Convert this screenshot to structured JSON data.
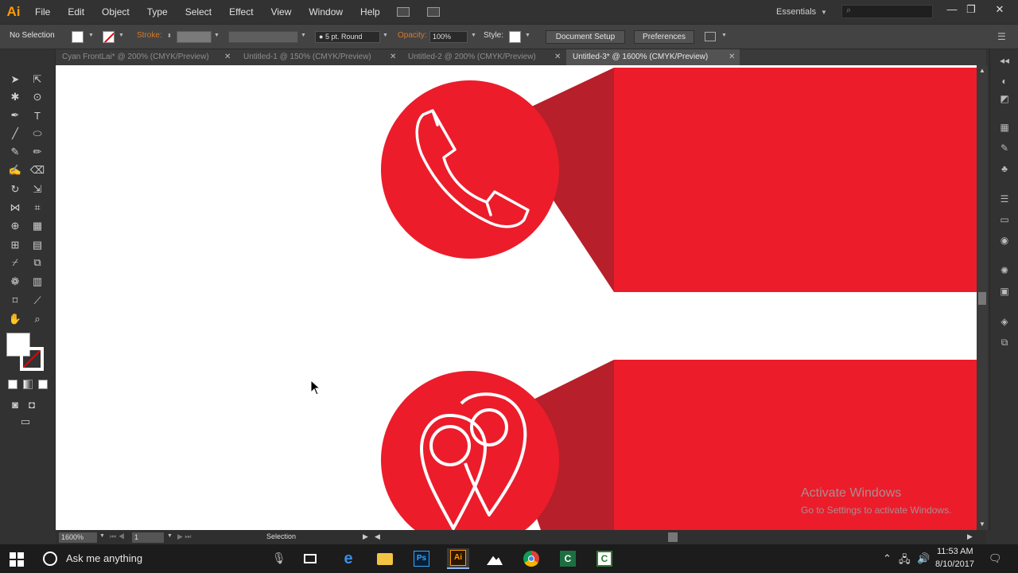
{
  "app": {
    "logo": "Ai"
  },
  "menu": [
    "File",
    "Edit",
    "Object",
    "Type",
    "Select",
    "Effect",
    "View",
    "Window",
    "Help"
  ],
  "workspace": "Essentials",
  "control_bar": {
    "selection": "No Selection",
    "stroke_label": "Stroke:",
    "brush": "5 pt. Round",
    "opacity_label": "Opacity:",
    "opacity_value": "100%",
    "style_label": "Style:",
    "document_setup": "Document Setup",
    "preferences": "Preferences"
  },
  "tabs": [
    {
      "label": "Cyan FrontLai* @ 200% (CMYK/Preview)",
      "active": false
    },
    {
      "label": "Untitled-1 @ 150% (CMYK/Preview)",
      "active": false
    },
    {
      "label": "Untitled-2 @ 200% (CMYK/Preview)",
      "active": false
    },
    {
      "label": "Untitled-3* @ 1600% (CMYK/Preview)",
      "active": true
    }
  ],
  "status_bar": {
    "zoom": "1600%",
    "artboard": "1",
    "tool": "Selection"
  },
  "artwork": {
    "accent": "#ec1c2b",
    "shadow": "#b71f2a",
    "icons": [
      "phone-icon",
      "location-pin-icon"
    ]
  },
  "watermark": {
    "title": "Activate Windows",
    "subtitle": "Go to Settings to activate Windows."
  },
  "taskbar": {
    "search_placeholder": "Ask me anything",
    "apps": [
      "task-view",
      "edge",
      "file-explorer",
      "photoshop",
      "illustrator",
      "photos",
      "chrome",
      "excel",
      "camtasia"
    ],
    "time": "11:53 AM",
    "date": "8/10/2017"
  }
}
